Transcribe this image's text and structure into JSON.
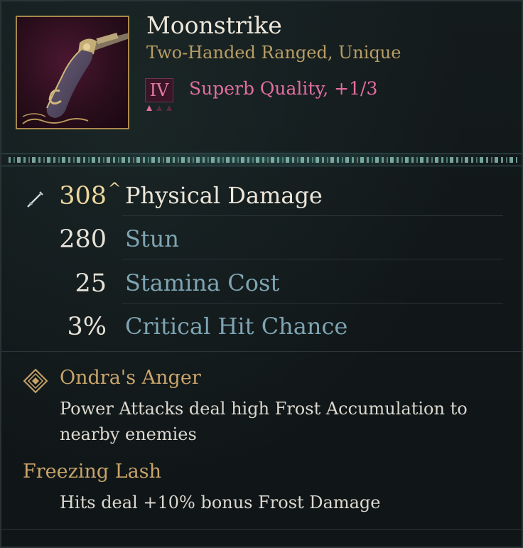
{
  "item": {
    "name": "Moonstrike",
    "type": "Two-Handed Ranged, Unique",
    "tier": "IV",
    "quality": "Superb Quality, +1/3",
    "icon": "flintlock-pistol-icon"
  },
  "stats": [
    {
      "value": "308",
      "label": "Physical Damage",
      "upgrade_indicator": "^",
      "icon": "sword-icon"
    },
    {
      "value": "280",
      "label": "Stun"
    },
    {
      "value": "25",
      "label": "Stamina Cost"
    },
    {
      "value": "3%",
      "label": "Critical Hit Chance"
    }
  ],
  "perks": [
    {
      "title": "Ondra's Anger",
      "description": "Power Attacks deal high Frost Accumulation to nearby enemies",
      "icon": "diamond-rune-icon"
    },
    {
      "title": "Freezing Lash",
      "description": "Hits deal +10% bonus Frost Damage"
    }
  ],
  "colors": {
    "background": "#111719",
    "name": "#ece6da",
    "type": "#b89e63",
    "quality": "#e36ea0",
    "primary_value": "#ecd79b",
    "stat_label": "#7ea4b2",
    "perk_title": "#c9a46a"
  }
}
